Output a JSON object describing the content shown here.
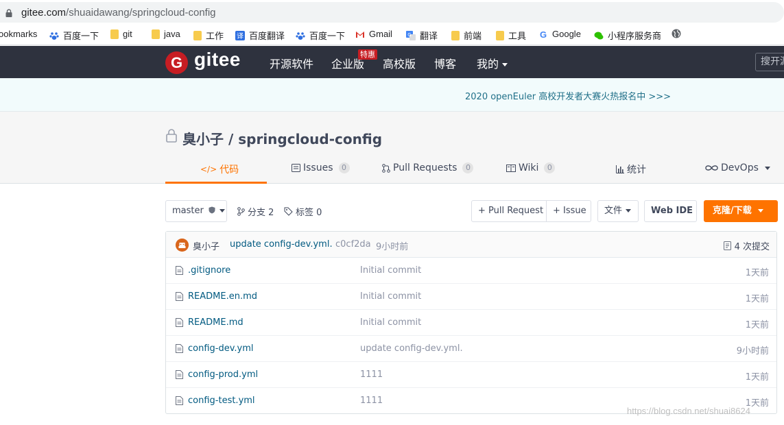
{
  "browser": {
    "url_host": "gitee.com",
    "url_path": "/shuaidawang/springcloud-config",
    "bookmarks": [
      "ookmarks",
      "百度一下",
      "git",
      "java",
      "工作",
      "百度翻译",
      "百度一下",
      "Gmail",
      "翻译",
      "前端",
      "工具",
      "Google",
      "小程序服务商"
    ]
  },
  "header": {
    "logo_letter": "G",
    "brand": "gitee",
    "nav": [
      "开源软件",
      "企业版",
      "高校版",
      "博客",
      "我的"
    ],
    "hot_badge": "特惠",
    "search_placeholder": "搜开源"
  },
  "banner": {
    "text": "2020 openEuler 高校开发者大赛火热报名中 >>>"
  },
  "project": {
    "title": "臭小子 / springcloud-config",
    "tabs": [
      {
        "icon_text": "</>",
        "label": "代码"
      },
      {
        "label": "Issues",
        "count": "0"
      },
      {
        "label": "Pull Requests",
        "count": "0"
      },
      {
        "label": "Wiki",
        "count": "0"
      },
      {
        "label": "统计"
      },
      {
        "label": "DevOps"
      }
    ]
  },
  "toolbar": {
    "branch": "master",
    "branches": "分支 2",
    "tags": "标签 0",
    "pull_request": "+ Pull Request",
    "issue": "+ Issue",
    "files": "文件",
    "web_ide": "Web IDE",
    "clone": "克隆/下载"
  },
  "commit": {
    "author": "臭小子",
    "message": "update config-dev.yml.",
    "hash": "c0cf2da",
    "time": "9小时前",
    "count": "4 次提交"
  },
  "files": [
    {
      "name": ".gitignore",
      "message": "Initial commit",
      "time": "1天前"
    },
    {
      "name": "README.en.md",
      "message": "Initial commit",
      "time": "1天前"
    },
    {
      "name": "README.md",
      "message": "Initial commit",
      "time": "1天前"
    },
    {
      "name": "config-dev.yml",
      "message": "update config-dev.yml.",
      "time": "9小时前"
    },
    {
      "name": "config-prod.yml",
      "message": "1111",
      "time": "1天前"
    },
    {
      "name": "config-test.yml",
      "message": "1111",
      "time": "1天前"
    }
  ],
  "watermark": "https://blog.csdn.net/shuai8624",
  "colors": {
    "header_bg": "#2e323e",
    "brand_red": "#c71d23",
    "accent_orange": "#fe7300",
    "link_blue": "#005980"
  }
}
